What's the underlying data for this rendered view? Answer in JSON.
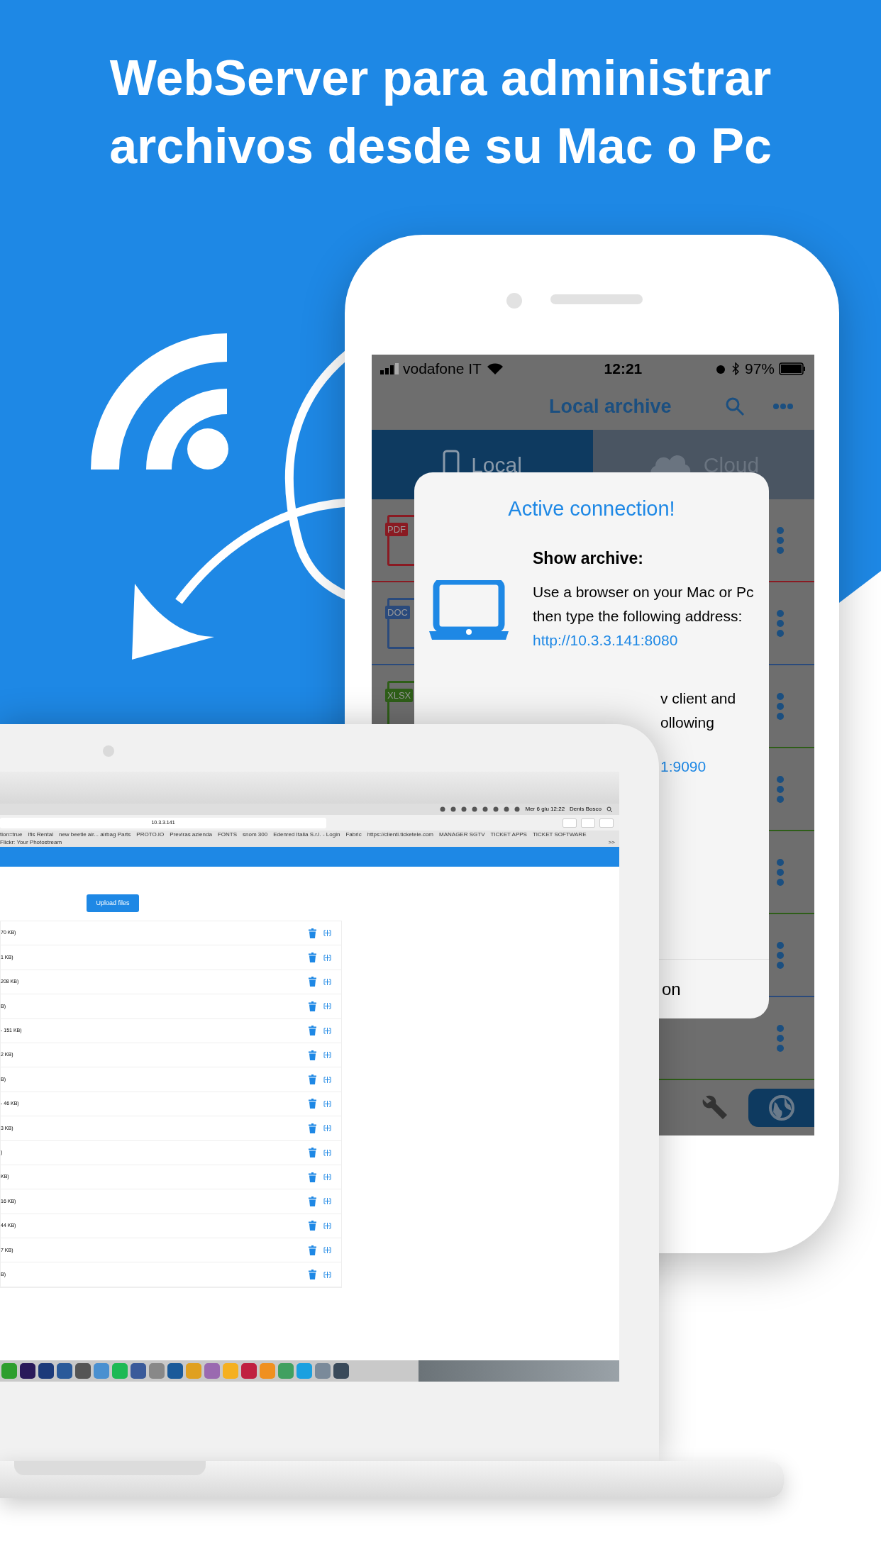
{
  "headline": [
    "WebServer para administrar",
    "archivos desde su Mac o Pc"
  ],
  "phone": {
    "status_bar": {
      "carrier": "vodafone IT",
      "time": "12:21",
      "battery": "97%"
    },
    "nav_title": "Local archive",
    "tabs": [
      {
        "label": "Local",
        "kind": "phone",
        "selected": true
      },
      {
        "label": "Cloud",
        "kind": "cloud",
        "selected": false
      }
    ],
    "files": [
      {
        "badge": "PDF",
        "color": "#8a1a22"
      },
      {
        "badge": "DOC",
        "color": "#2a4a7c"
      },
      {
        "badge": "XLSX",
        "color": "#2e5e18"
      },
      {
        "color": "#2e5e18"
      },
      {
        "color": "#2e5e18"
      },
      {
        "color": "#2a4a7c"
      },
      {
        "color": "#2e5e18"
      }
    ],
    "bottom_tabs": [
      {
        "kind": "wrench",
        "selected": false
      },
      {
        "kind": "globe",
        "selected": true
      }
    ],
    "dialog": {
      "title": "Active connection!",
      "heading": "Show archive:",
      "text": "Use a browser on your Mac or Pc then type the following address:",
      "link": "http://10.3.3.141:8080",
      "text_2_lines": [
        "v client and",
        "ollowing"
      ],
      "link_2": "1:9090",
      "button": "on"
    }
  },
  "laptop": {
    "menu_bar": {
      "clock": "Mer 6 giu 12:22",
      "user": "Denis Bosco"
    },
    "address": "10.3.3.141",
    "bookmarks": [
      "tion=true",
      "Ifis Rental",
      "new beetle air... airbag Parts",
      "PROTO.IO",
      "Previras azienda",
      "FONTS",
      "snom 300",
      "Edenred Italia S.r.l. - Login",
      "Fabric",
      "https://clienti.ticketele.com",
      "MANAGER SGTV",
      "TICKET APPS",
      "TICKET SOFTWARE",
      "Flickr: Your Photostream"
    ],
    "bookmarks_more": ">>",
    "upload_button": "Upload files",
    "rows": [
      {
        "size": "70 KB)"
      },
      {
        "size": "1 KB)"
      },
      {
        "size": "208 KB)"
      },
      {
        "size": "B)"
      },
      {
        "size": "- 151 KB)"
      },
      {
        "size": "2 KB)"
      },
      {
        "size": "B)"
      },
      {
        "size": "- 46 KB)"
      },
      {
        "size": "3 KB)"
      },
      {
        "size": ")"
      },
      {
        "size": "KB)"
      },
      {
        "size": "16 KB)"
      },
      {
        "size": "44 KB)"
      },
      {
        "size": "7 KB)"
      },
      {
        "size": "B)"
      }
    ]
  }
}
